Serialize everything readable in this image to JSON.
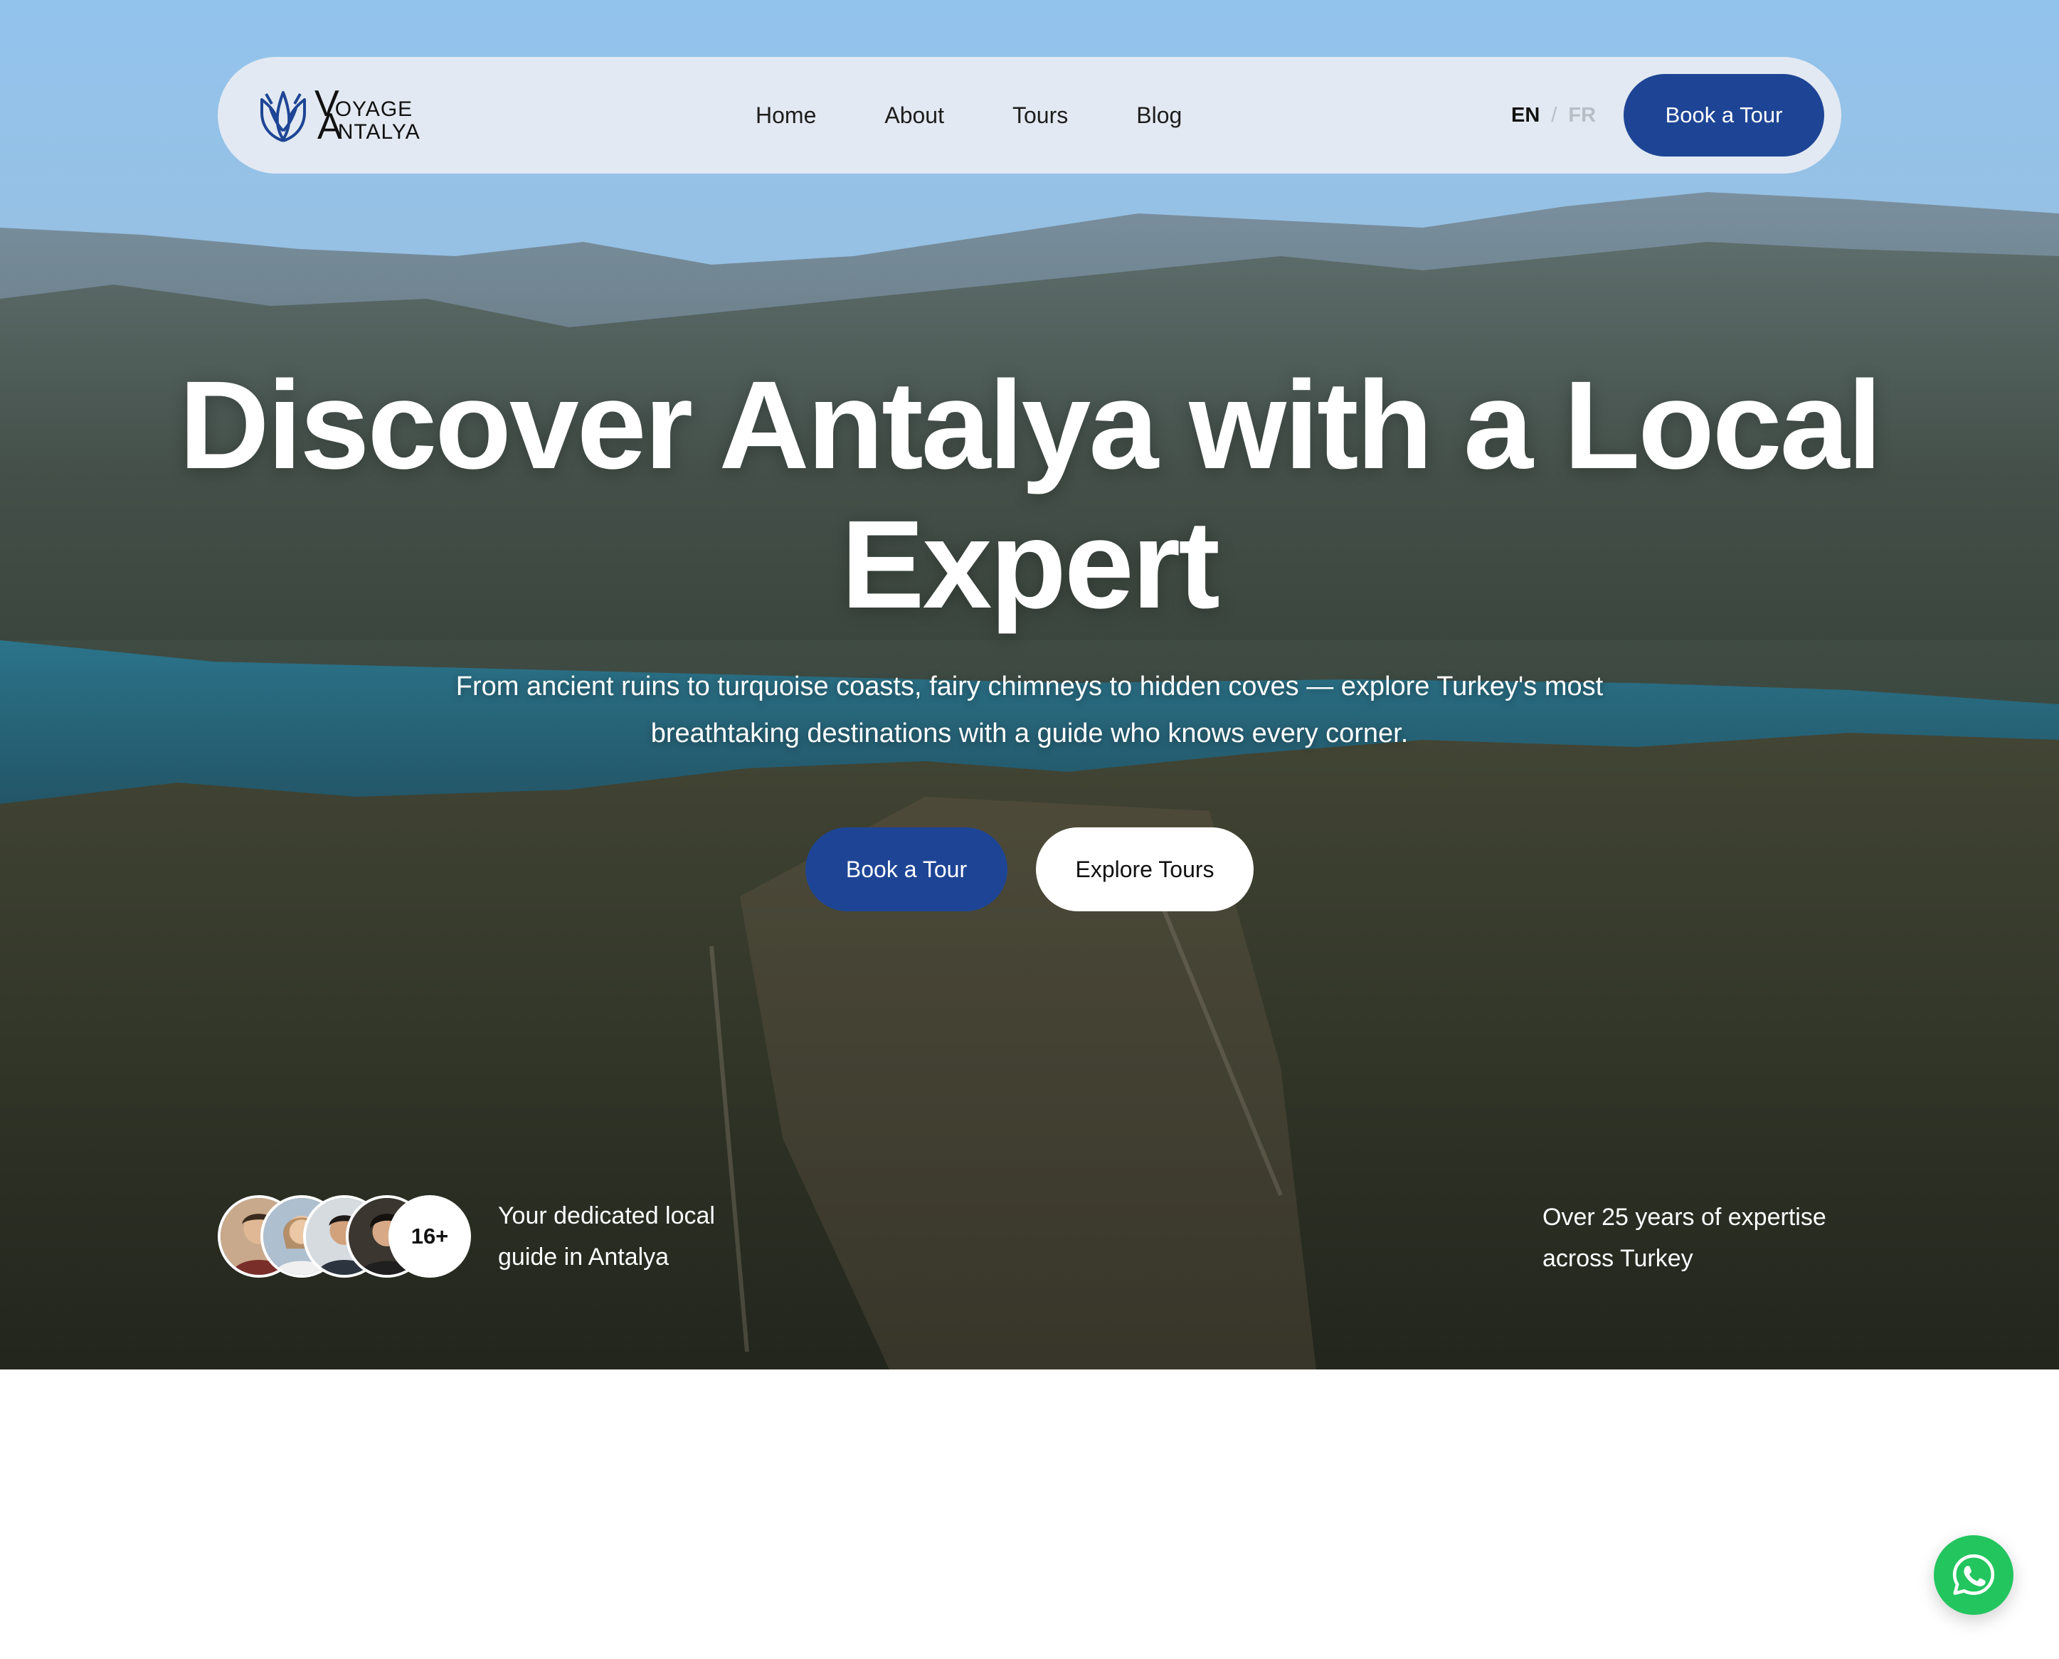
{
  "brand": {
    "logo_initial_1": "V",
    "logo_rest_1": "OYAGE",
    "logo_initial_2": "A",
    "logo_rest_2": "NTALYA",
    "accent_color": "#1e4595"
  },
  "nav": {
    "links": [
      {
        "label": "Home"
      },
      {
        "label": "About"
      },
      {
        "label": "Tours"
      },
      {
        "label": "Blog"
      }
    ],
    "language": {
      "active": "EN",
      "separator": "/",
      "inactive": "FR"
    },
    "cta_label": "Book a Tour"
  },
  "hero": {
    "title_line_1": "Discover Antalya with a Local",
    "title_line_2": "Expert",
    "subtitle_line_1": "From ancient ruins to turquoise coasts, fairy chimneys to hidden coves — explore Turkey's most",
    "subtitle_line_2": "breathtaking destinations with a guide who knows every corner.",
    "primary_button": "Book a Tour",
    "secondary_button": "Explore Tours"
  },
  "stats": {
    "guides_count": "16+",
    "guides_text_line_1": "Your dedicated local",
    "guides_text_line_2": "guide in Antalya",
    "expertise_line_1": "Over 25 years of expertise",
    "expertise_line_2": "across Turkey"
  },
  "icons": {
    "logo": "tulip-logo-icon",
    "whatsapp": "whatsapp-icon"
  },
  "colors": {
    "whatsapp": "#22c55e",
    "nav_bg": "#e8ecf2"
  }
}
